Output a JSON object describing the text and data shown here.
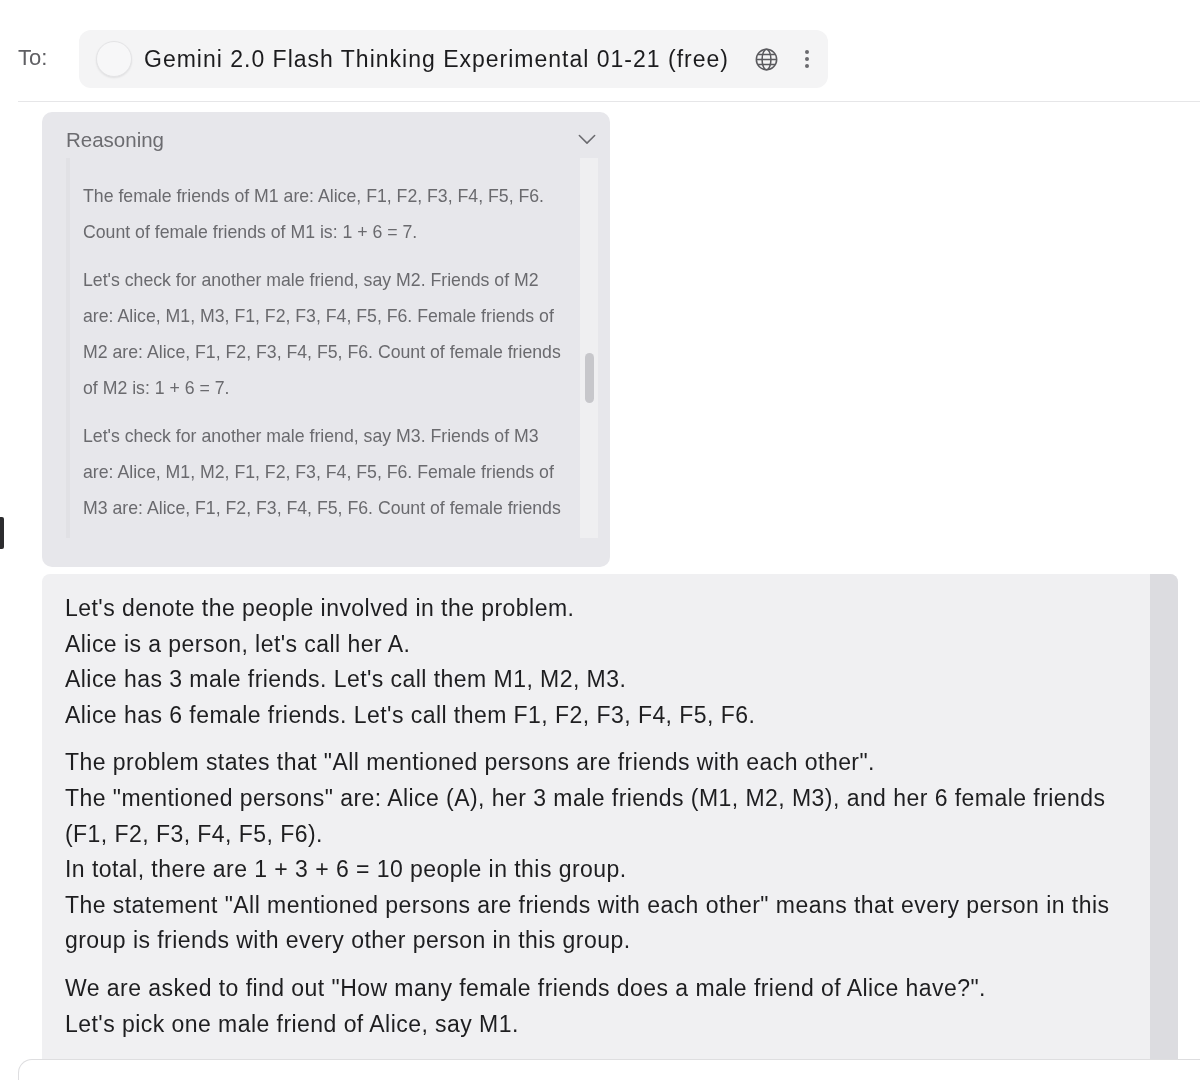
{
  "header": {
    "to_label": "To:",
    "model": {
      "name": "Gemini 2.0 Flash Thinking Experimental 01-21 (free)"
    }
  },
  "reasoning": {
    "title": "Reasoning",
    "expanded": true,
    "paragraphs": [
      [
        "The female friends of M1 are: Alice, F1, F2, F3, F4, F5, F6.",
        "Count of female friends of M1 is: 1 + 6 = 7."
      ],
      [
        "Let's check for another male friend, say M2. Friends of M2 are: Alice, M1, M3, F1, F2, F3, F4, F5, F6. Female friends of M2 are: Alice, F1, F2, F3, F4, F5, F6. Count of female friends of M2 is: 1 + 6 = 7."
      ],
      [
        "Let's check for another male friend, say M3. Friends of M3 are: Alice, M1, M2, F1, F2, F3, F4, F5, F6. Female friends of M3 are: Alice, F1, F2, F3, F4, F5, F6. Count of female friends"
      ]
    ]
  },
  "answer": {
    "paragraphs": [
      [
        "Let's denote the people involved in the problem.",
        "Alice is a person, let's call her A.",
        "Alice has 3 male friends. Let's call them M1, M2, M3.",
        "Alice has 6 female friends. Let's call them F1, F2, F3, F4, F5, F6."
      ],
      [
        "The problem states that \"All mentioned persons are friends with each other\".",
        "The \"mentioned persons\" are: Alice (A), her 3 male friends (M1, M2, M3), and her 6 female friends (F1, F2, F3, F4, F5, F6).",
        "In total, there are 1 + 3 + 6 = 10 people in this group.",
        "The statement \"All mentioned persons are friends with each other\" means that every person in this group is friends with every other person in this group."
      ],
      [
        "We are asked to find out \"How many female friends does a male friend of Alice have?\".",
        "Let's pick one male friend of Alice, say M1."
      ]
    ]
  }
}
